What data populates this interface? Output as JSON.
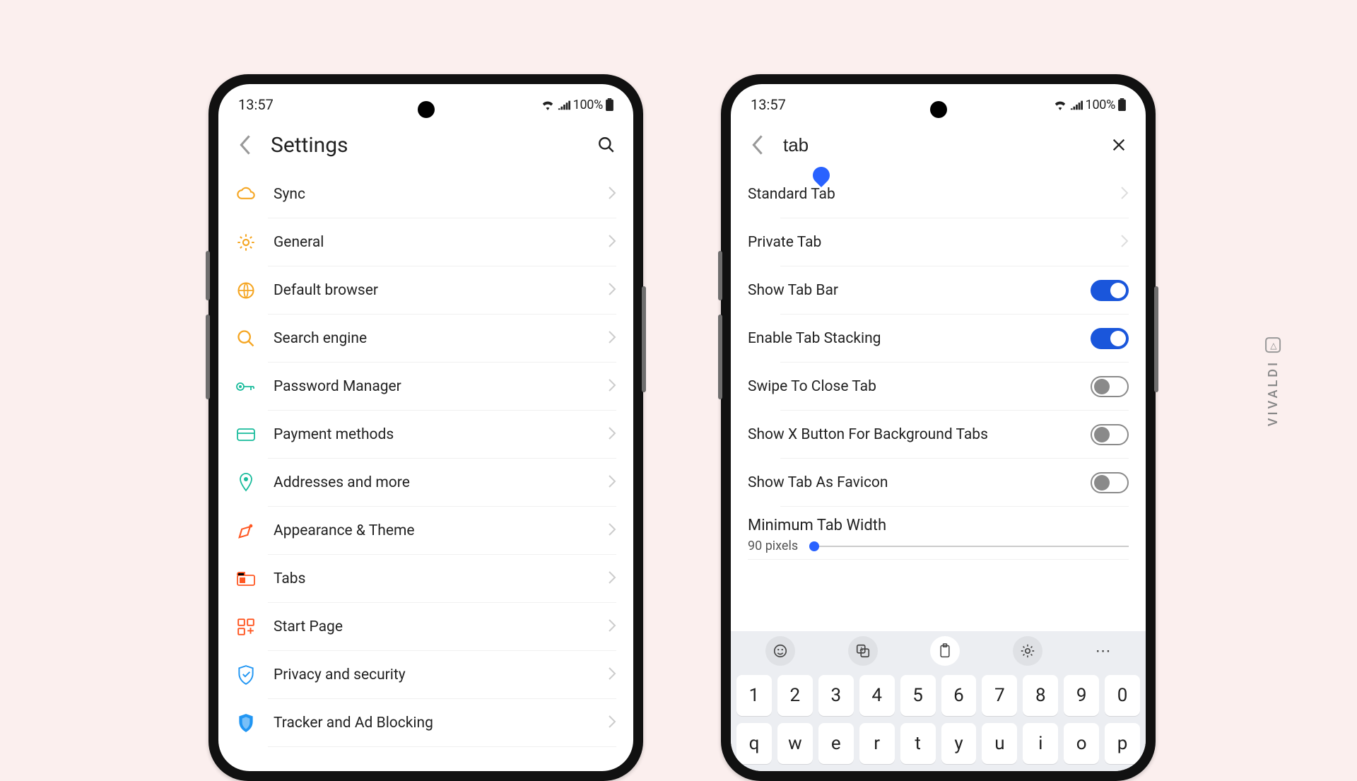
{
  "status": {
    "time": "13:57",
    "battery": "100%"
  },
  "screen1": {
    "title": "Settings",
    "items": [
      {
        "label": "Sync"
      },
      {
        "label": "General"
      },
      {
        "label": "Default browser"
      },
      {
        "label": "Search engine"
      },
      {
        "label": "Password Manager"
      },
      {
        "label": "Payment methods"
      },
      {
        "label": "Addresses and more"
      },
      {
        "label": "Appearance & Theme"
      },
      {
        "label": "Tabs"
      },
      {
        "label": "Start Page"
      },
      {
        "label": "Privacy and security"
      },
      {
        "label": "Tracker and Ad Blocking"
      }
    ]
  },
  "screen2": {
    "search_value": "tab",
    "rows": [
      {
        "label": "Standard Tab",
        "type": "nav"
      },
      {
        "label": "Private Tab",
        "type": "nav"
      },
      {
        "label": "Show Tab Bar",
        "type": "toggle",
        "on": true
      },
      {
        "label": "Enable Tab Stacking",
        "type": "toggle",
        "on": true
      },
      {
        "label": "Swipe To Close Tab",
        "type": "toggle",
        "on": false
      },
      {
        "label": "Show X Button For Background Tabs",
        "type": "toggle",
        "on": false
      },
      {
        "label": "Show Tab As Favicon",
        "type": "toggle",
        "on": false
      }
    ],
    "slider": {
      "title": "Minimum Tab Width",
      "value_label": "90 pixels"
    }
  },
  "keyboard": {
    "row1": [
      "1",
      "2",
      "3",
      "4",
      "5",
      "6",
      "7",
      "8",
      "9",
      "0"
    ],
    "row2": [
      "q",
      "w",
      "e",
      "r",
      "t",
      "y",
      "u",
      "i",
      "o",
      "p"
    ]
  },
  "brand": "VIVALDI"
}
